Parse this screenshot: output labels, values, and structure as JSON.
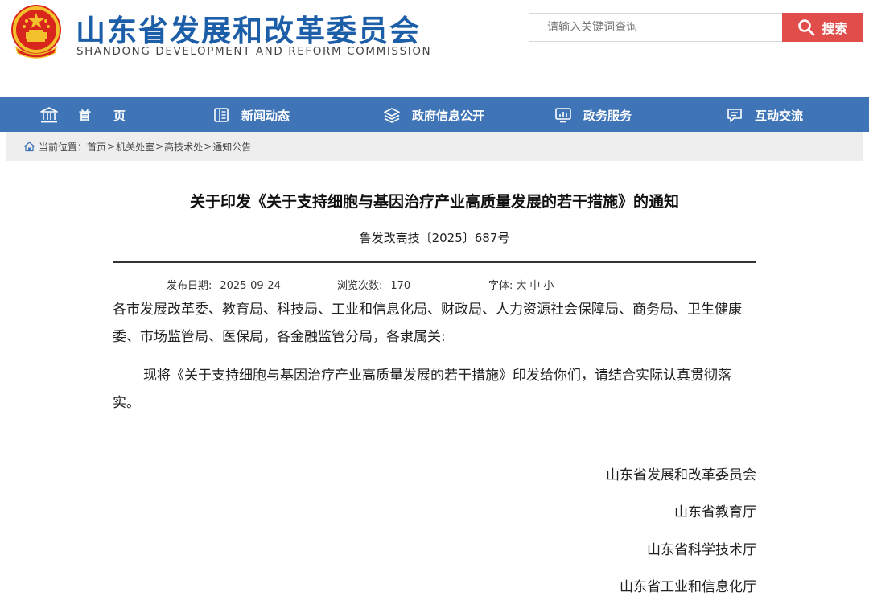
{
  "header": {
    "title": "山东省发展和改革委员会",
    "subtitle": "SHANDONG DEVELOPMENT AND REFORM COMMISSION",
    "search_placeholder": "请输入关键词查询",
    "search_button": "搜索"
  },
  "nav": {
    "items": [
      {
        "label": "首页",
        "icon": "building-icon"
      },
      {
        "label": "新闻动态",
        "icon": "news-icon"
      },
      {
        "label": "政府信息公开",
        "icon": "layers-icon"
      },
      {
        "label": "政务服务",
        "icon": "monitor-icon"
      },
      {
        "label": "互动交流",
        "icon": "chat-icon"
      }
    ]
  },
  "breadcrumb": {
    "prefix": "当前位置：",
    "items": [
      "首页",
      "机关处室",
      "高技术处",
      "通知公告"
    ]
  },
  "article": {
    "title": "关于印发《关于支持细胞与基因治疗产业高质量发展的若干措施》的通知",
    "doc_number": "鲁发改高技〔2025〕687号",
    "meta": {
      "date_label": "发布日期:",
      "date": "2025-09-24",
      "views_label": "浏览次数:",
      "views": "170",
      "font_label": "字体:",
      "font_sizes": [
        "大",
        "中",
        "小"
      ]
    },
    "salutation": "各市发展改革委、教育局、科技局、工业和信息化局、财政局、人力资源社会保障局、商务局、卫生健康委、市场监管局、医保局，各金融监管分局，各隶属关:",
    "paragraph": "现将《关于支持细胞与基因治疗产业高质量发展的若干措施》印发给你们，请结合实际认真贯彻落实。",
    "signatures": [
      "山东省发展和改革委员会",
      "山东省教育厅",
      "山东省科学技术厅",
      "山东省工业和信息化厅"
    ]
  },
  "colors": {
    "brand_blue": "#1d5ea8",
    "nav_blue": "#3f75b6",
    "search_red": "#e04d4a",
    "breadcrumb_bg": "#eeeeee"
  }
}
